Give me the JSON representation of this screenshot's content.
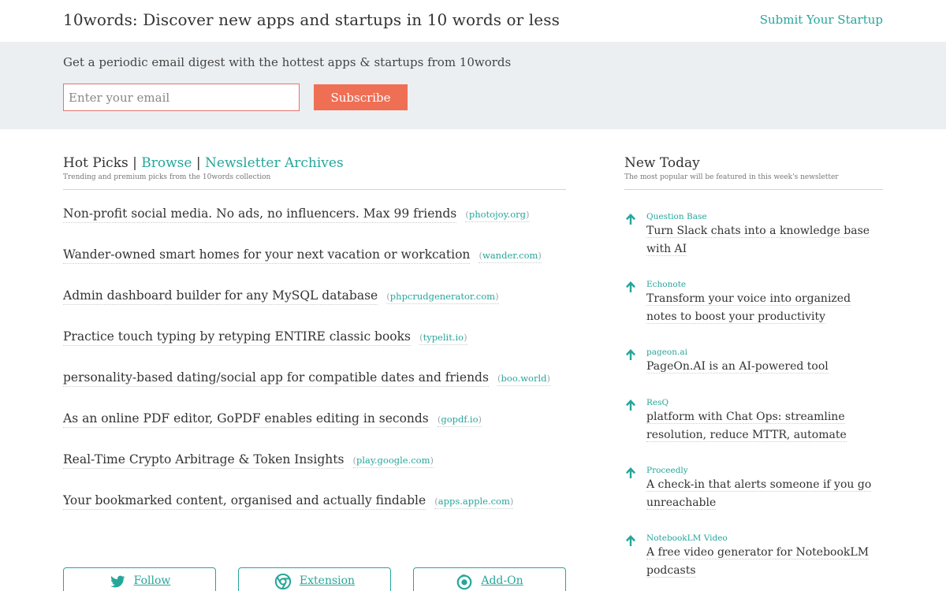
{
  "header": {
    "title": "10words: Discover new apps and startups in 10 words or less",
    "submit_label": "Submit Your Startup"
  },
  "digest": {
    "text": "Get a periodic email digest with the hottest apps & startups from 10words",
    "email_placeholder": "Enter your email",
    "subscribe_label": "Subscribe"
  },
  "hot_picks": {
    "title": "Hot Picks",
    "separator": "|",
    "browse_label": "Browse",
    "archives_label": "Newsletter Archives",
    "subtitle": "Trending and premium picks from the 10words collection",
    "items": [
      {
        "text": "Non-profit social media. No ads, no influencers. Max 99 friends",
        "domain": "photojoy.org"
      },
      {
        "text": "Wander-owned smart homes for your next vacation or workcation",
        "domain": "wander.com"
      },
      {
        "text": "Admin dashboard builder for any MySQL database",
        "domain": "phpcrudgenerator.com"
      },
      {
        "text": "Practice touch typing by retyping ENTIRE classic books",
        "domain": "typelit.io"
      },
      {
        "text": "personality-based dating/social app for compatible dates and friends",
        "domain": "boo.world"
      },
      {
        "text": "As an online PDF editor, GoPDF enables editing in seconds",
        "domain": "gopdf.io"
      },
      {
        "text": "Real-Time Crypto Arbitrage & Token Insights",
        "domain": "play.google.com"
      },
      {
        "text": "Your bookmarked content, organised and actually findable",
        "domain": "apps.apple.com"
      }
    ]
  },
  "new_today": {
    "title": "New Today",
    "subtitle": "The most popular will be featured in this week's newsletter",
    "items": [
      {
        "name": "Question Base",
        "desc": "Turn Slack chats into a knowledge base with AI"
      },
      {
        "name": "Echonote",
        "desc": "Transform your voice into organized notes to boost your productivity"
      },
      {
        "name": "pageon.ai",
        "desc": "PageOn.AI is an AI-powered tool"
      },
      {
        "name": "ResQ",
        "desc": "platform with Chat Ops: streamline resolution, reduce MTTR, automate"
      },
      {
        "name": "Proceedly",
        "desc": "A check-in that alerts someone if you go unreachable"
      },
      {
        "name": "NotebookLM Video",
        "desc": "A free video generator for NotebookLM podcasts"
      }
    ]
  },
  "buttons": {
    "follow_label": "Follow",
    "extension_label": "Extension",
    "addon_label": "Add-On"
  },
  "colors": {
    "accent": "#26a69a",
    "subscribe": "#ef6f55",
    "digest_bg": "#eceff2"
  }
}
